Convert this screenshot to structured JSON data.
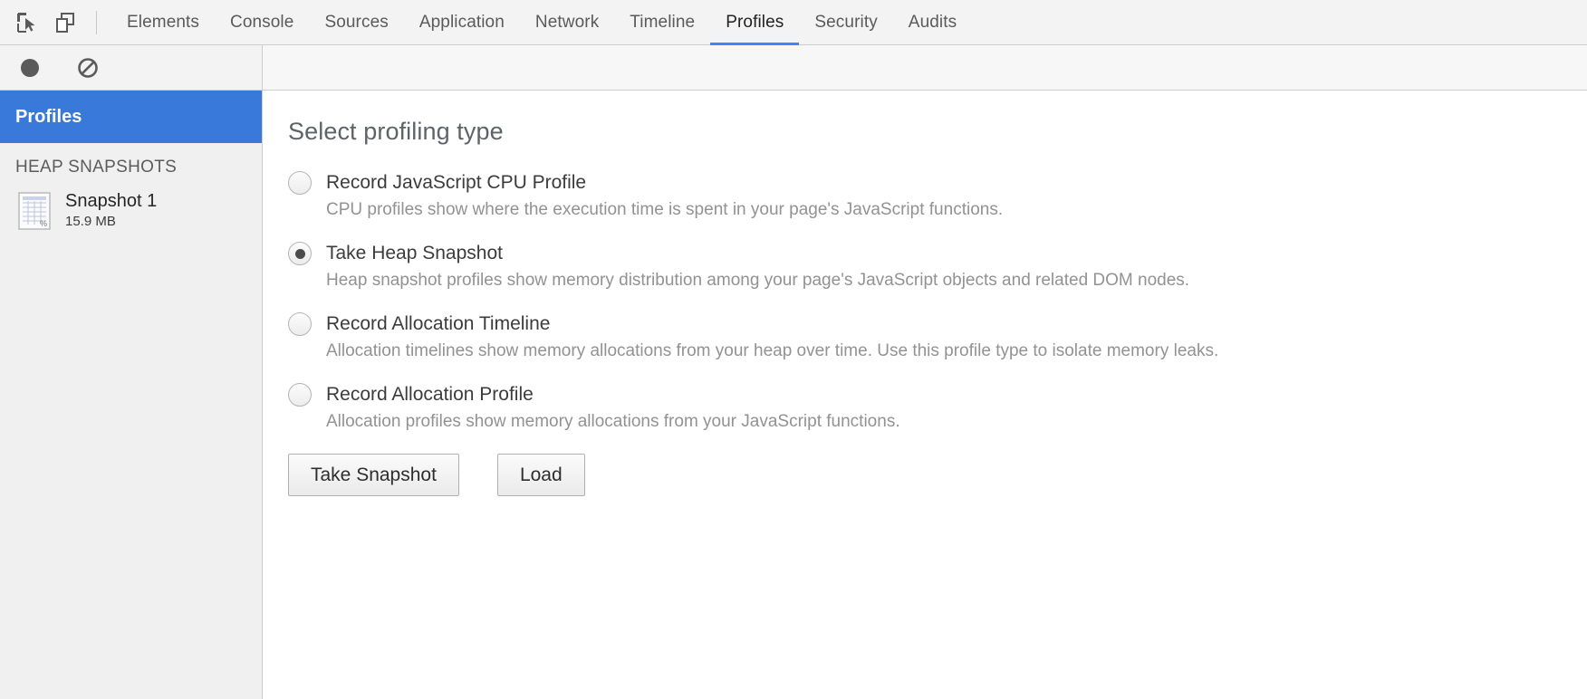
{
  "toolbar": {
    "inspect_icon": "inspect-cursor-icon",
    "device_icon": "device-toolbar-icon",
    "tabs": [
      {
        "label": "Elements",
        "active": false
      },
      {
        "label": "Console",
        "active": false
      },
      {
        "label": "Sources",
        "active": false
      },
      {
        "label": "Application",
        "active": false
      },
      {
        "label": "Network",
        "active": false
      },
      {
        "label": "Timeline",
        "active": false
      },
      {
        "label": "Profiles",
        "active": true
      },
      {
        "label": "Security",
        "active": false
      },
      {
        "label": "Audits",
        "active": false
      }
    ],
    "active_tab": "Profiles",
    "accent_color": "#4285f4"
  },
  "subtoolbar": {
    "record_icon": "record-circle-icon",
    "clear_icon": "clear-prohibited-icon"
  },
  "sidebar": {
    "header_label": "Profiles",
    "header_color": "#3879d9",
    "section_title": "HEAP SNAPSHOTS",
    "items": [
      {
        "icon": "heap-snapshot-grid-icon",
        "title": "Snapshot 1",
        "size": "15.9 MB"
      }
    ]
  },
  "main": {
    "title": "Select profiling type",
    "options": [
      {
        "label": "Record JavaScript CPU Profile",
        "description": "CPU profiles show where the execution time is spent in your page's JavaScript functions.",
        "selected": false
      },
      {
        "label": "Take Heap Snapshot",
        "description": "Heap snapshot profiles show memory distribution among your page's JavaScript objects and related DOM nodes.",
        "selected": true
      },
      {
        "label": "Record Allocation Timeline",
        "description": "Allocation timelines show memory allocations from your heap over time. Use this profile type to isolate memory leaks.",
        "selected": false
      },
      {
        "label": "Record Allocation Profile",
        "description": "Allocation profiles show memory allocations from your JavaScript functions.",
        "selected": false
      }
    ],
    "buttons": {
      "primary_label": "Take Snapshot",
      "secondary_label": "Load"
    }
  }
}
